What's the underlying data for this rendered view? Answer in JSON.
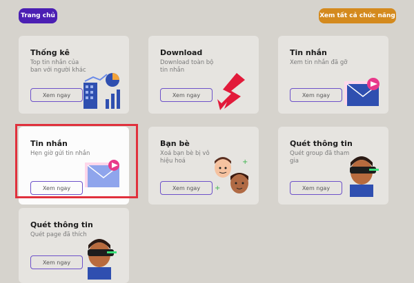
{
  "header": {
    "home_label": "Trang chủ",
    "all_features_label": "Xem tất cả chức năng"
  },
  "cards": [
    {
      "title": "Thống kê",
      "desc": "Top tin nhắn của ban với người khác",
      "button": "Xem ngay",
      "icon": "statistics-chart-icon"
    },
    {
      "title": "Download",
      "desc": "Download toàn bộ tin nhắn",
      "button": "Xem ngay",
      "icon": "download-arrow-icon"
    },
    {
      "title": "Tin nhắn",
      "desc": "Xem tin nhắn đã gỡ",
      "button": "Xem ngay",
      "icon": "envelope-icon"
    },
    {
      "title": "Tin nhắn",
      "desc": "Hẹn giờ gửi tin nhắn",
      "button": "Xem ngay",
      "icon": "envelope-icon"
    },
    {
      "title": "Bạn bè",
      "desc": "Xoá bạn bè bị vô hiệu hoá",
      "button": "Xem ngay",
      "icon": "friends-faces-icon"
    },
    {
      "title": "Quét thông tin",
      "desc": "Quét group đã tham gia",
      "button": "Xem ngay",
      "icon": "vr-person-icon"
    },
    {
      "title": "Quét thông tin",
      "desc": "Quét page đã thích",
      "button": "Xem ngay",
      "icon": "vr-person-icon"
    }
  ],
  "colors": {
    "primary": "#4b1fb3",
    "accent": "#d48a1e",
    "highlight": "#e0303c"
  }
}
